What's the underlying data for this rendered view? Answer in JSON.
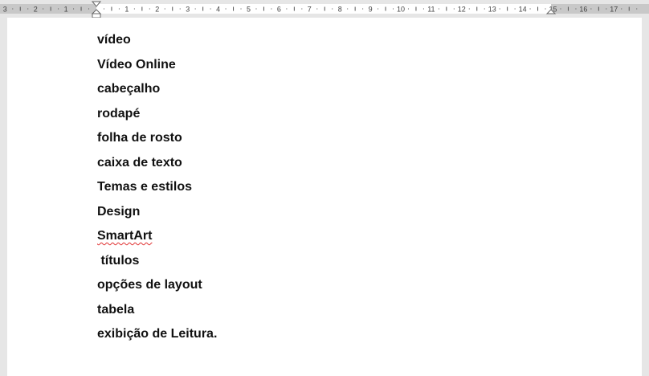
{
  "ruler": {
    "left_labels": [
      "3",
      "2",
      "1"
    ],
    "right_labels": [
      "1",
      "2",
      "3",
      "4",
      "5",
      "6",
      "7",
      "8",
      "9",
      "10",
      "11",
      "12",
      "13",
      "14",
      "15",
      "16",
      "17"
    ]
  },
  "document": {
    "lines": [
      {
        "text": "vídeo",
        "spell_error": false
      },
      {
        "text": "Vídeo Online",
        "spell_error": false
      },
      {
        "text": "cabeçalho",
        "spell_error": false
      },
      {
        "text": "rodapé",
        "spell_error": false
      },
      {
        "text": "folha de rosto",
        "spell_error": false
      },
      {
        "text": "caixa de texto",
        "spell_error": false
      },
      {
        "text": "Temas e estilos",
        "spell_error": false
      },
      {
        "text": "Design",
        "spell_error": false
      },
      {
        "text": "SmartArt",
        "spell_error": true
      },
      {
        "text": " títulos",
        "spell_error": false
      },
      {
        "text": "opções de layout",
        "spell_error": false
      },
      {
        "text": "tabela",
        "spell_error": false
      },
      {
        "text": "exibição de Leitura.",
        "spell_error": false
      }
    ]
  }
}
